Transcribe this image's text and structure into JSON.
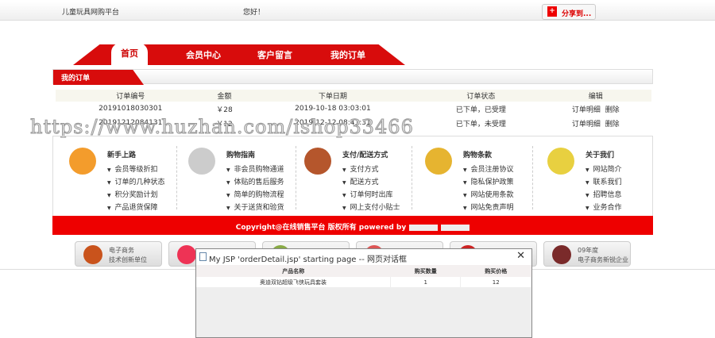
{
  "header": {
    "site_name": "儿童玩具网购平台",
    "greeting": "您好！",
    "share_label": "分享到..."
  },
  "nav": {
    "tabs": [
      "首页",
      "会员中心",
      "客户留言",
      "我的订单"
    ]
  },
  "section_title": "我的订单",
  "orders": {
    "columns": [
      "订单编号",
      "金额",
      "下单日期",
      "订单状态",
      "编辑"
    ],
    "rows": [
      {
        "id": "20191018030301",
        "amount": "￥28",
        "date": "2019-10-18 03:03:01",
        "status": "已下单，已受理",
        "detail": "订单明细",
        "delete": "删除"
      },
      {
        "id": "20191212084131",
        "amount": "￥12",
        "date": "2019-12-12 08:41:31",
        "status": "已下单，未受理",
        "detail": "订单明细",
        "delete": "删除"
      }
    ]
  },
  "watermark": "https://www.huzhan.com/ishop33466",
  "help": [
    {
      "title": "新手上路",
      "items": [
        "会员等级折扣",
        "订单的几种状态",
        "积分奖励计划",
        "产品退货保障"
      ]
    },
    {
      "title": "购物指南",
      "items": [
        "非会员购物通道",
        "体贴的售后服务",
        "简单的购物流程",
        "关于送货和验货"
      ]
    },
    {
      "title": "支付/配送方式",
      "items": [
        "支付方式",
        "配送方式",
        "订单何时出库",
        "网上支付小贴士"
      ]
    },
    {
      "title": "购物条款",
      "items": [
        "会员注册协议",
        "隐私保护政策",
        "网站使用条款",
        "网站免责声明"
      ]
    },
    {
      "title": "关于我们",
      "items": [
        "网站简介",
        "联系我们",
        "招聘信息",
        "业务合作"
      ]
    }
  ],
  "footer": {
    "copyright": "Copyright@在线销售平台 版权所有 powered by"
  },
  "badges": [
    {
      "line1": "电子商务",
      "line2": "技术创新单位"
    },
    {
      "line1": "09年度",
      "line2": "电子商务新锐企业"
    }
  ],
  "dialog": {
    "title": "My JSP 'orderDetail.jsp' starting page -- 网页对话框",
    "columns": [
      "产品名称",
      "购买数量",
      "购买价格"
    ],
    "rows": [
      {
        "name": "奥迪双钻超级飞侠玩具套装",
        "qty": "1",
        "price": "12"
      }
    ]
  }
}
